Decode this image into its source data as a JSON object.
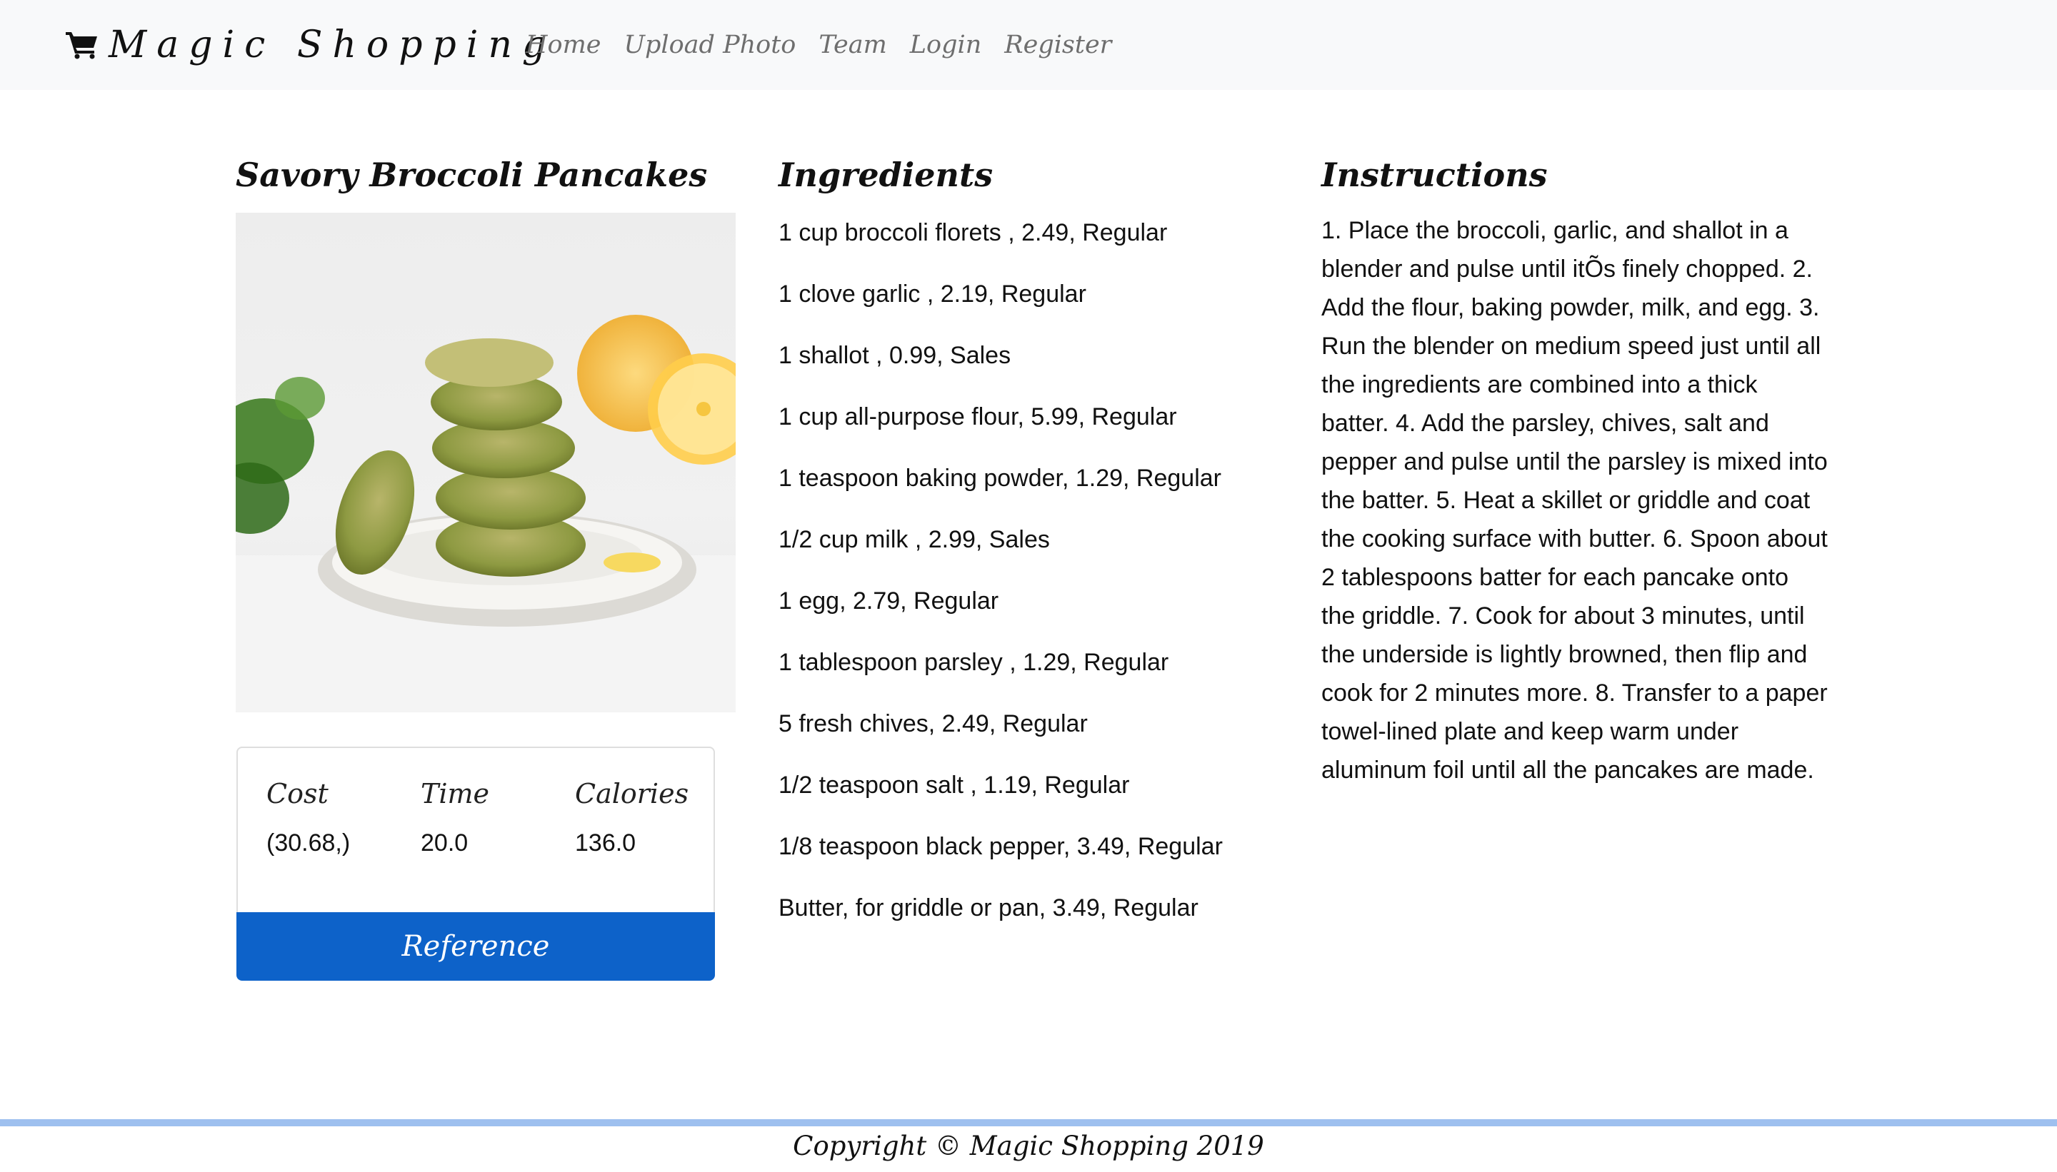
{
  "nav": {
    "brand": "Magic Shopping",
    "brand_icon": "shopping-cart-icon",
    "links": [
      "Home",
      "Upload Photo",
      "Team",
      "Login",
      "Register"
    ]
  },
  "recipe": {
    "title": "Savory Broccoli Pancakes",
    "image_alt": "stack of broccoli pancakes on a plate",
    "stats": {
      "cost_label": "Cost",
      "cost_value": "(30.68,)",
      "time_label": "Time",
      "time_value": "20.0",
      "calories_label": "Calories",
      "calories_value": "136.0"
    },
    "reference_label": "Reference"
  },
  "ingredients": {
    "heading": "Ingredients",
    "items": [
      "1 cup broccoli florets , 2.49, Regular",
      "1 clove garlic , 2.19, Regular",
      "1 shallot , 0.99, Sales",
      "1 cup all-purpose flour, 5.99, Regular",
      "1 teaspoon baking powder, 1.29, Regular",
      "1/2 cup milk , 2.99, Sales",
      "1 egg, 2.79, Regular",
      "1 tablespoon parsley , 1.29, Regular",
      "5 fresh chives, 2.49, Regular",
      "1/2 teaspoon salt , 1.19, Regular",
      "1/8 teaspoon black pepper, 3.49, Regular",
      "Butter, for griddle or pan, 3.49, Regular"
    ]
  },
  "instructions": {
    "heading": "Instructions",
    "text": "1. Place the broccoli, garlic, and shallot in a blender and pulse until itÕs finely chopped. 2. Add the flour, baking powder, milk, and egg. 3. Run the blender on medium speed just until all the ingredients are combined into a thick batter. 4. Add the parsley, chives, salt and pepper and pulse until the parsley is mixed into the batter. 5. Heat a skillet or griddle and coat the cooking surface with butter. 6. Spoon about 2 tablespoons batter for each pancake onto the griddle. 7. Cook for about 3 minutes, until the underside is lightly browned, then flip and cook for 2 minutes more. 8. Transfer to a paper towel-lined plate and keep warm under aluminum foil until all the pancakes are made."
  },
  "footer": {
    "text": "Copyright © Magic Shopping 2019"
  },
  "colors": {
    "navbar_bg": "#f8f9fa",
    "nav_link": "#6e6e6e",
    "button_primary": "#0d62c9",
    "footer_rule": "#9ec0ef"
  }
}
